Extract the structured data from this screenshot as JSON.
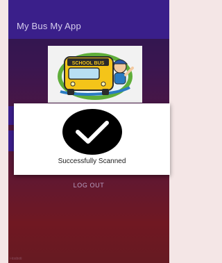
{
  "app_bar": {
    "title": "My Bus My App"
  },
  "logo": {
    "bus_sign": "SCHOOL BUS"
  },
  "dialog": {
    "message": "Successfully Scanned",
    "icon": "check-circle-icon"
  },
  "actions": {
    "logout_label": "LOG OUT"
  },
  "watermark": {
    "text": "i-tosboti"
  },
  "colors": {
    "app_bar": "#3a1f8a",
    "stripe": "#3c1e8c",
    "bg_top": "#2a1650",
    "bg_bottom": "#701822",
    "bus_yellow": "#f4c419"
  }
}
